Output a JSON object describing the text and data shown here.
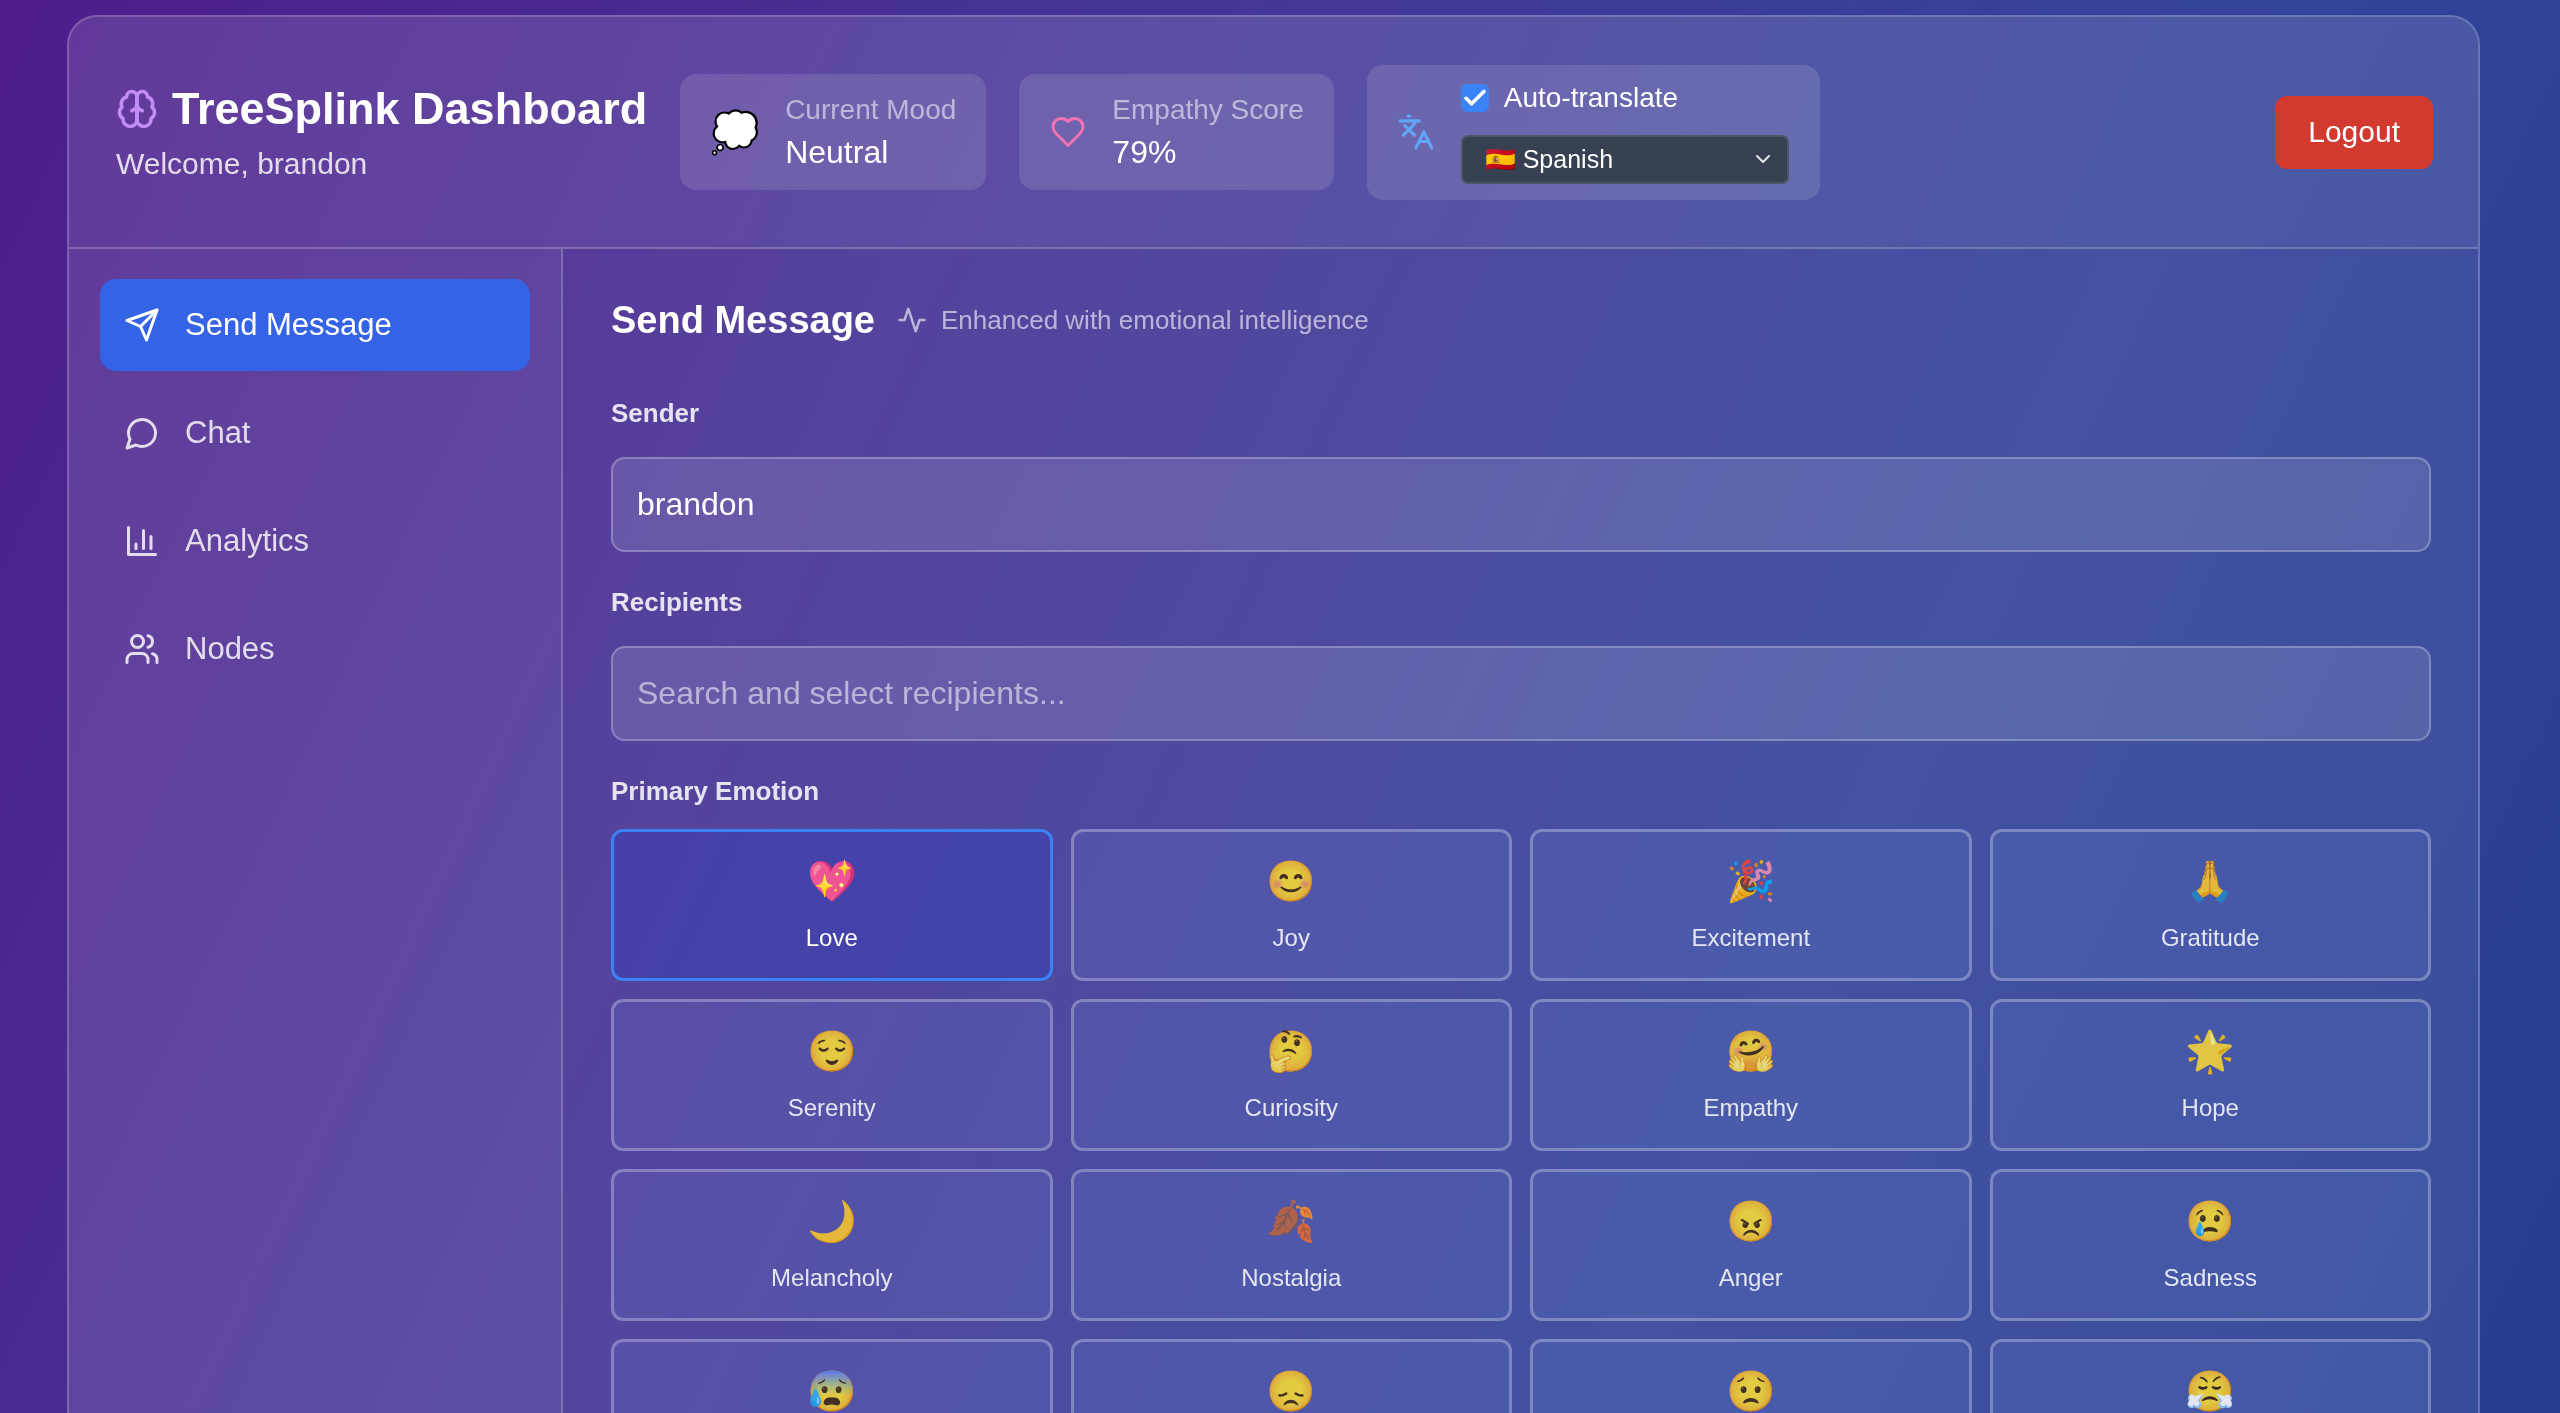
{
  "header": {
    "title": "TreeSplink Dashboard",
    "welcome": "Welcome, brandon"
  },
  "stats": [
    {
      "kind": "mood",
      "emoji": "💭",
      "label": "Current Mood",
      "value": "Neutral"
    },
    {
      "kind": "empathy",
      "label": "Empathy Score",
      "value": "79%"
    }
  ],
  "translate": {
    "checked": true,
    "label": "Auto-translate",
    "value": "🇪🇸 Spanish"
  },
  "logout": "Logout",
  "sidebar": {
    "items": [
      {
        "kind": "send",
        "label": "Send Message",
        "selected": true
      },
      {
        "kind": "chat",
        "label": "Chat",
        "selected": false
      },
      {
        "kind": "analytics",
        "label": "Analytics",
        "selected": false
      },
      {
        "kind": "nodes",
        "label": "Nodes",
        "selected": false
      }
    ]
  },
  "main": {
    "title": "Send Message",
    "subtitle": "Enhanced with emotional intelligence",
    "fields": [
      {
        "label": "Sender",
        "value": "brandon"
      },
      {
        "label": "Recipients",
        "placeholder": "Search and select recipients..."
      }
    ],
    "emotion_label": "Primary Emotion",
    "emotions": [
      {
        "emoji": "💖",
        "label": "Love",
        "selected": true
      },
      {
        "emoji": "😊",
        "label": "Joy",
        "selected": false
      },
      {
        "emoji": "🎉",
        "label": "Excitement",
        "selected": false
      },
      {
        "emoji": "🙏",
        "label": "Gratitude",
        "selected": false
      },
      {
        "emoji": "😌",
        "label": "Serenity",
        "selected": false
      },
      {
        "emoji": "🤔",
        "label": "Curiosity",
        "selected": false
      },
      {
        "emoji": "🤗",
        "label": "Empathy",
        "selected": false
      },
      {
        "emoji": "🌟",
        "label": "Hope",
        "selected": false
      },
      {
        "emoji": "🌙",
        "label": "Melancholy",
        "selected": false
      },
      {
        "emoji": "🍂",
        "label": "Nostalgia",
        "selected": false
      },
      {
        "emoji": "😠",
        "label": "Anger",
        "selected": false
      },
      {
        "emoji": "😢",
        "label": "Sadness",
        "selected": false
      },
      {
        "emoji": "😰",
        "selected": false
      },
      {
        "emoji": "😞",
        "selected": false
      },
      {
        "emoji": "😟",
        "selected": false
      },
      {
        "emoji": "😤",
        "selected": false
      }
    ]
  }
}
